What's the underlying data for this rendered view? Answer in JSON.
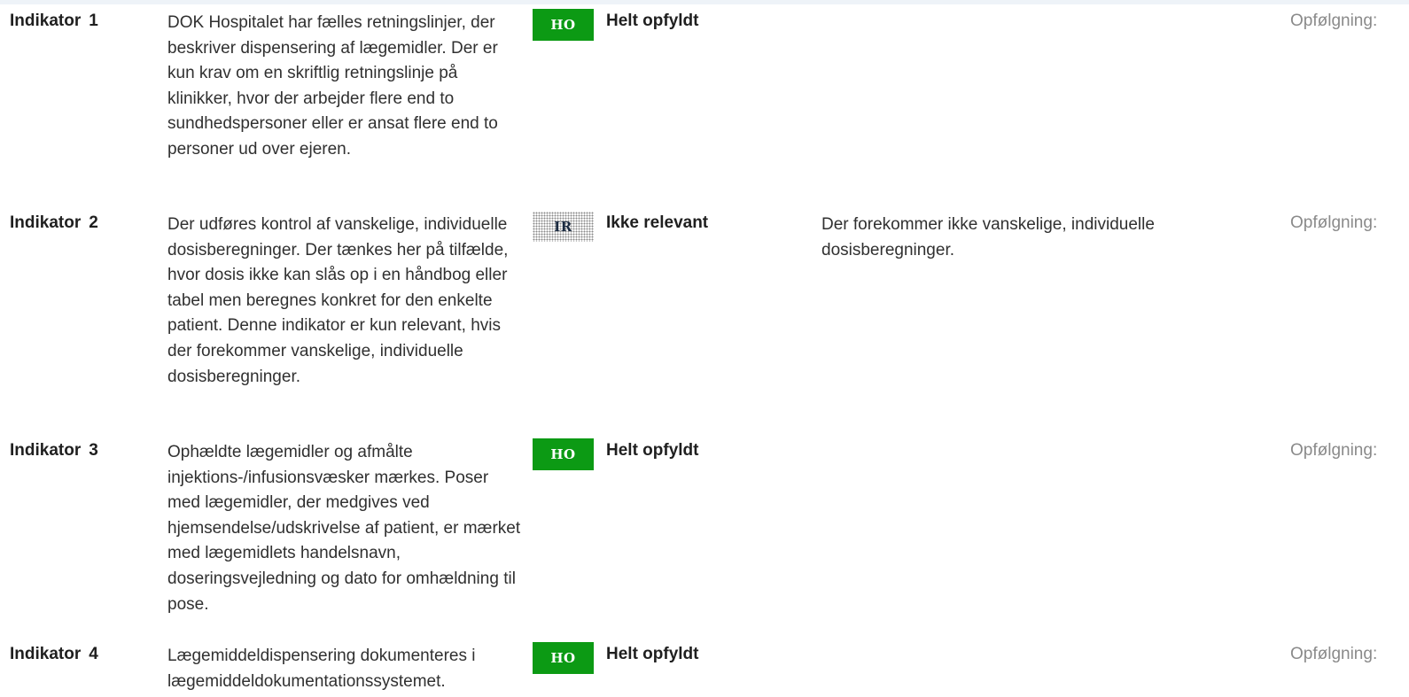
{
  "indicators": [
    {
      "label": "Indikator",
      "number": "1",
      "description": "DOK Hospitalet har fælles retningslinjer, der beskriver dispensering af lægemidler.   Der er kun krav om en skriftlig retningslinje på klinikker, hvor der arbejder flere end to sundhedspersoner eller er ansat flere end to personer ud over ejeren.",
      "badge": "HO",
      "badge_type": "ho",
      "status": "Helt opfyldt",
      "comment": "",
      "followup": "Opfølgning:"
    },
    {
      "label": "Indikator",
      "number": "2",
      "description": "Der udføres kontrol af vanskelige, individuelle dosisberegninger.   Der tænkes her på tilfælde, hvor dosis ikke kan slås op i en håndbog eller tabel men beregnes konkret for den enkelte patient.   Denne indikator er kun relevant, hvis der forekommer vanskelige, individuelle dosisberegninger.",
      "badge": "IR",
      "badge_type": "ir",
      "status": "Ikke relevant",
      "comment": "Der forekommer ikke vanskelige, individuelle dosisberegninger.",
      "followup": "Opfølgning:"
    },
    {
      "label": "Indikator",
      "number": "3",
      "description": "Ophældte lægemidler og afmålte injektions-/infusionsvæsker mærkes. Poser med lægemidler, der medgives ved hjemsendelse/udskrivelse af patient, er mærket med lægemidlets handelsnavn, doseringsvejledning og dato for omhældning til pose.",
      "badge": "HO",
      "badge_type": "ho",
      "status": "Helt opfyldt",
      "comment": "",
      "followup": "Opfølgning:"
    },
    {
      "label": "Indikator",
      "number": "4",
      "description": "Lægemiddeldispensering dokumenteres i lægemiddeldokumentationssystemet.",
      "badge": "HO",
      "badge_type": "ho",
      "status": "Helt opfyldt",
      "comment": "",
      "followup": "Opfølgning:"
    }
  ],
  "colors": {
    "ho_badge": "#0c9a14",
    "followup_text": "#8a8a8a"
  }
}
